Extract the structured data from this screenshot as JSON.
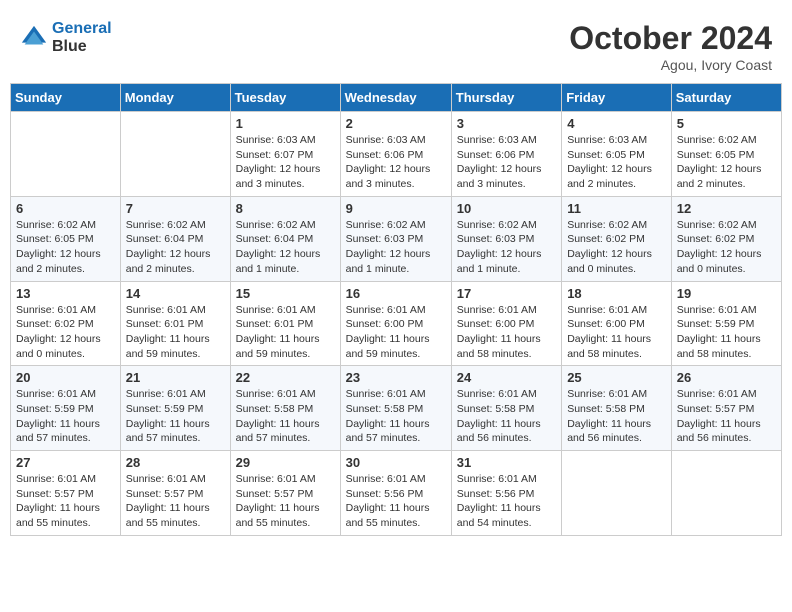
{
  "logo": {
    "line1": "General",
    "line2": "Blue"
  },
  "title": "October 2024",
  "location": "Agou, Ivory Coast",
  "weekdays": [
    "Sunday",
    "Monday",
    "Tuesday",
    "Wednesday",
    "Thursday",
    "Friday",
    "Saturday"
  ],
  "weeks": [
    [
      {
        "day": "",
        "info": ""
      },
      {
        "day": "",
        "info": ""
      },
      {
        "day": "1",
        "info": "Sunrise: 6:03 AM\nSunset: 6:07 PM\nDaylight: 12 hours and 3 minutes."
      },
      {
        "day": "2",
        "info": "Sunrise: 6:03 AM\nSunset: 6:06 PM\nDaylight: 12 hours and 3 minutes."
      },
      {
        "day": "3",
        "info": "Sunrise: 6:03 AM\nSunset: 6:06 PM\nDaylight: 12 hours and 3 minutes."
      },
      {
        "day": "4",
        "info": "Sunrise: 6:03 AM\nSunset: 6:05 PM\nDaylight: 12 hours and 2 minutes."
      },
      {
        "day": "5",
        "info": "Sunrise: 6:02 AM\nSunset: 6:05 PM\nDaylight: 12 hours and 2 minutes."
      }
    ],
    [
      {
        "day": "6",
        "info": "Sunrise: 6:02 AM\nSunset: 6:05 PM\nDaylight: 12 hours and 2 minutes."
      },
      {
        "day": "7",
        "info": "Sunrise: 6:02 AM\nSunset: 6:04 PM\nDaylight: 12 hours and 2 minutes."
      },
      {
        "day": "8",
        "info": "Sunrise: 6:02 AM\nSunset: 6:04 PM\nDaylight: 12 hours and 1 minute."
      },
      {
        "day": "9",
        "info": "Sunrise: 6:02 AM\nSunset: 6:03 PM\nDaylight: 12 hours and 1 minute."
      },
      {
        "day": "10",
        "info": "Sunrise: 6:02 AM\nSunset: 6:03 PM\nDaylight: 12 hours and 1 minute."
      },
      {
        "day": "11",
        "info": "Sunrise: 6:02 AM\nSunset: 6:02 PM\nDaylight: 12 hours and 0 minutes."
      },
      {
        "day": "12",
        "info": "Sunrise: 6:02 AM\nSunset: 6:02 PM\nDaylight: 12 hours and 0 minutes."
      }
    ],
    [
      {
        "day": "13",
        "info": "Sunrise: 6:01 AM\nSunset: 6:02 PM\nDaylight: 12 hours and 0 minutes."
      },
      {
        "day": "14",
        "info": "Sunrise: 6:01 AM\nSunset: 6:01 PM\nDaylight: 11 hours and 59 minutes."
      },
      {
        "day": "15",
        "info": "Sunrise: 6:01 AM\nSunset: 6:01 PM\nDaylight: 11 hours and 59 minutes."
      },
      {
        "day": "16",
        "info": "Sunrise: 6:01 AM\nSunset: 6:00 PM\nDaylight: 11 hours and 59 minutes."
      },
      {
        "day": "17",
        "info": "Sunrise: 6:01 AM\nSunset: 6:00 PM\nDaylight: 11 hours and 58 minutes."
      },
      {
        "day": "18",
        "info": "Sunrise: 6:01 AM\nSunset: 6:00 PM\nDaylight: 11 hours and 58 minutes."
      },
      {
        "day": "19",
        "info": "Sunrise: 6:01 AM\nSunset: 5:59 PM\nDaylight: 11 hours and 58 minutes."
      }
    ],
    [
      {
        "day": "20",
        "info": "Sunrise: 6:01 AM\nSunset: 5:59 PM\nDaylight: 11 hours and 57 minutes."
      },
      {
        "day": "21",
        "info": "Sunrise: 6:01 AM\nSunset: 5:59 PM\nDaylight: 11 hours and 57 minutes."
      },
      {
        "day": "22",
        "info": "Sunrise: 6:01 AM\nSunset: 5:58 PM\nDaylight: 11 hours and 57 minutes."
      },
      {
        "day": "23",
        "info": "Sunrise: 6:01 AM\nSunset: 5:58 PM\nDaylight: 11 hours and 57 minutes."
      },
      {
        "day": "24",
        "info": "Sunrise: 6:01 AM\nSunset: 5:58 PM\nDaylight: 11 hours and 56 minutes."
      },
      {
        "day": "25",
        "info": "Sunrise: 6:01 AM\nSunset: 5:58 PM\nDaylight: 11 hours and 56 minutes."
      },
      {
        "day": "26",
        "info": "Sunrise: 6:01 AM\nSunset: 5:57 PM\nDaylight: 11 hours and 56 minutes."
      }
    ],
    [
      {
        "day": "27",
        "info": "Sunrise: 6:01 AM\nSunset: 5:57 PM\nDaylight: 11 hours and 55 minutes."
      },
      {
        "day": "28",
        "info": "Sunrise: 6:01 AM\nSunset: 5:57 PM\nDaylight: 11 hours and 55 minutes."
      },
      {
        "day": "29",
        "info": "Sunrise: 6:01 AM\nSunset: 5:57 PM\nDaylight: 11 hours and 55 minutes."
      },
      {
        "day": "30",
        "info": "Sunrise: 6:01 AM\nSunset: 5:56 PM\nDaylight: 11 hours and 55 minutes."
      },
      {
        "day": "31",
        "info": "Sunrise: 6:01 AM\nSunset: 5:56 PM\nDaylight: 11 hours and 54 minutes."
      },
      {
        "day": "",
        "info": ""
      },
      {
        "day": "",
        "info": ""
      }
    ]
  ]
}
